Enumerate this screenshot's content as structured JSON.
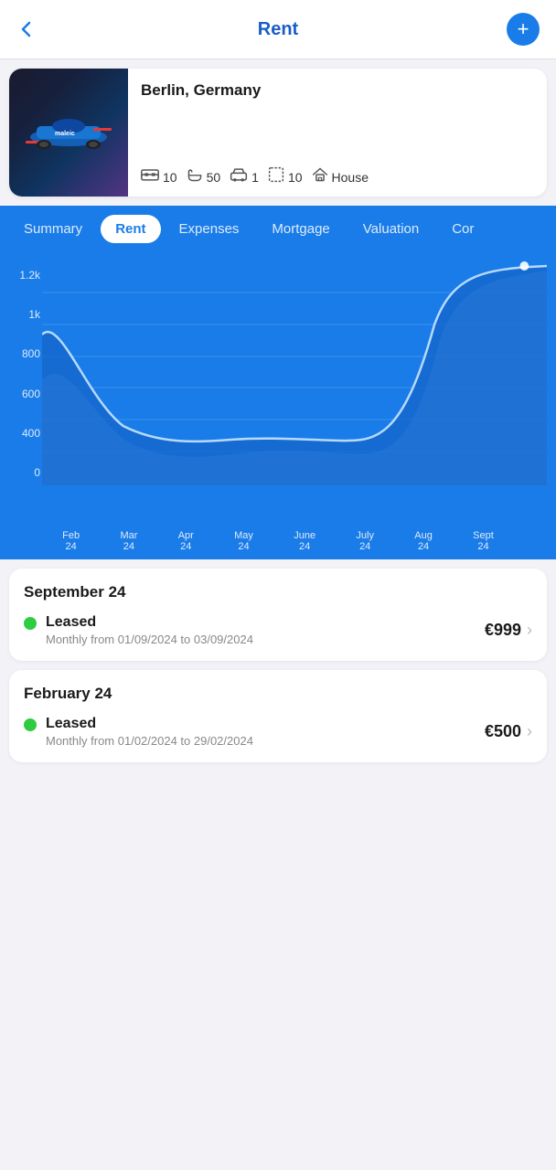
{
  "header": {
    "title": "Rent",
    "back_label": "‹",
    "add_label": "+"
  },
  "property": {
    "location": "Berlin, Germany",
    "stats": [
      {
        "icon": "bed",
        "value": "10",
        "name": "beds"
      },
      {
        "icon": "bath",
        "value": "50",
        "name": "baths"
      },
      {
        "icon": "car",
        "value": "1",
        "name": "garage"
      },
      {
        "icon": "area",
        "value": "10",
        "name": "area"
      },
      {
        "icon": "house",
        "value": "House",
        "name": "type"
      }
    ]
  },
  "tabs": [
    {
      "label": "Summary",
      "active": false
    },
    {
      "label": "Rent",
      "active": true
    },
    {
      "label": "Expenses",
      "active": false
    },
    {
      "label": "Mortgage",
      "active": false
    },
    {
      "label": "Valuation",
      "active": false
    },
    {
      "label": "Cor",
      "active": false
    }
  ],
  "chart": {
    "y_labels": [
      "0",
      "400",
      "600",
      "800",
      "1k",
      "1.2k"
    ],
    "x_labels": [
      {
        "month": "Feb",
        "year": "24"
      },
      {
        "month": "Mar",
        "year": "24"
      },
      {
        "month": "Apr",
        "year": "24"
      },
      {
        "month": "May",
        "year": "24"
      },
      {
        "month": "June",
        "year": "24"
      },
      {
        "month": "July",
        "year": "24"
      },
      {
        "month": "Aug",
        "year": "24"
      },
      {
        "month": "Sept",
        "year": "24"
      }
    ]
  },
  "lease_groups": [
    {
      "period": "September 24",
      "items": [
        {
          "status": "Leased",
          "date_range": "Monthly from 01/09/2024 to 03/09/2024",
          "amount": "€999"
        }
      ]
    },
    {
      "period": "February 24",
      "items": [
        {
          "status": "Leased",
          "date_range": "Monthly from 01/02/2024 to 29/02/2024",
          "amount": "€500"
        }
      ]
    }
  ]
}
